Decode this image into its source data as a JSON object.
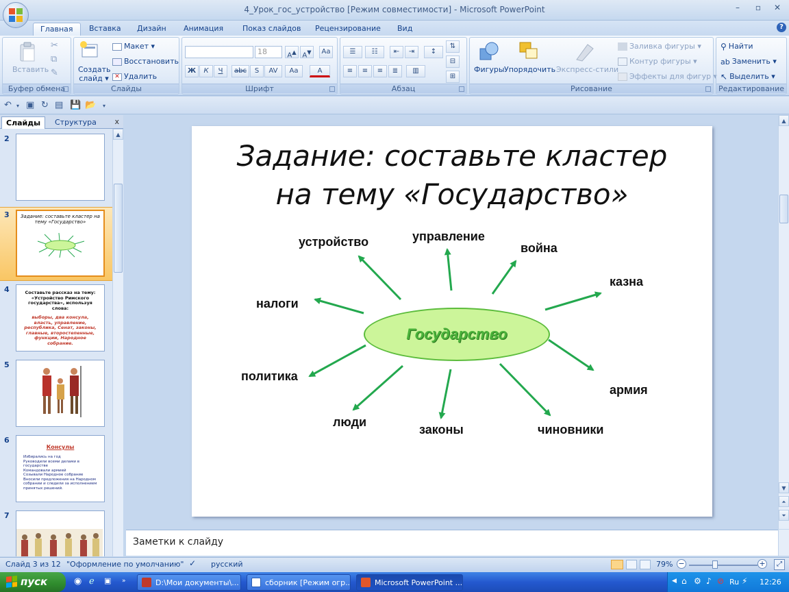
{
  "window": {
    "title": "4_Урок_гос_устройство [Режим совместимости] - Microsoft PowerPoint",
    "controls": [
      "–",
      "▫",
      "✕"
    ]
  },
  "ribbon": {
    "tabs": [
      "Главная",
      "Вставка",
      "Дизайн",
      "Анимация",
      "Показ слайдов",
      "Рецензирование",
      "Вид"
    ],
    "active_tab": "Главная",
    "clipboard": {
      "label": "Буфер обмена",
      "paste": "Вставить"
    },
    "slides": {
      "label": "Слайды",
      "new_slide": "Создать слайд ▾",
      "layout": "Макет ▾",
      "reset": "Восстановить",
      "delete": "Удалить"
    },
    "font": {
      "label": "Шрифт",
      "font_name": "",
      "font_size": "18"
    },
    "paragraph": {
      "label": "Абзац"
    },
    "drawing": {
      "label": "Рисование",
      "shapes": "Фигуры",
      "arrange": "Упорядочить",
      "quick_styles": "Экспресс-стили",
      "fill": "Заливка фигуры ▾",
      "outline": "Контур фигуры ▾",
      "effects": "Эффекты для фигур ▾"
    },
    "editing": {
      "label": "Редактирование",
      "find": "Найти",
      "replace": "Заменить ▾",
      "select": "Выделить ▾"
    }
  },
  "left_pane": {
    "tabs": [
      "Слайды",
      "Структура"
    ],
    "close": "x",
    "thumbnails": [
      {
        "num": "2"
      },
      {
        "num": "3",
        "title": "Задание: составьте кластер на тему «Государство»"
      },
      {
        "num": "4",
        "title": "Составьте рассказ на тему: «Устройство Римского государства», используя слова:",
        "body": "выборы, два консула, власть, управление, республика, Сенат, законы, главные, второстепенные, функции, Народное собрание."
      },
      {
        "num": "5"
      },
      {
        "num": "6",
        "title": "Консулы",
        "bullets": [
          "Избирались на год",
          "Руководили всеми делами в государстве",
          "Командовали армией",
          "Созывали Народное собрание",
          "Вносили предложения на Народном собрании и следили за исполнением принятых решений."
        ]
      },
      {
        "num": "7"
      }
    ]
  },
  "slide": {
    "title_line1": "Задание: составьте кластер",
    "title_line2": "на тему  «Государство»",
    "center": "Государство",
    "words": {
      "ustroystvo": "устройство",
      "upravlenie": "управление",
      "voyna": "война",
      "kazna": "казна",
      "nalogi": "налоги",
      "politika": "политика",
      "armiya": "армия",
      "lyudi": "люди",
      "zakony": "законы",
      "chinovniki": "чиновники"
    },
    "colors": {
      "arrow": "#23a84e",
      "ellipse_fill": "#ccf59a",
      "ellipse_border": "#5cbc3c",
      "center_text": "#4ab23a"
    }
  },
  "notes": {
    "placeholder": "Заметки к слайду"
  },
  "status": {
    "slide_info": "Слайд 3 из 12",
    "theme": "\"Оформление по умолчанию\"",
    "language": "русский",
    "zoom": "79%"
  },
  "taskbar": {
    "start": "пуск",
    "tasks": [
      "D:\\Мои документы\\...",
      "сборник [Режим огр...",
      "Microsoft PowerPoint ..."
    ],
    "lang": "Ru",
    "time": "12:26"
  }
}
